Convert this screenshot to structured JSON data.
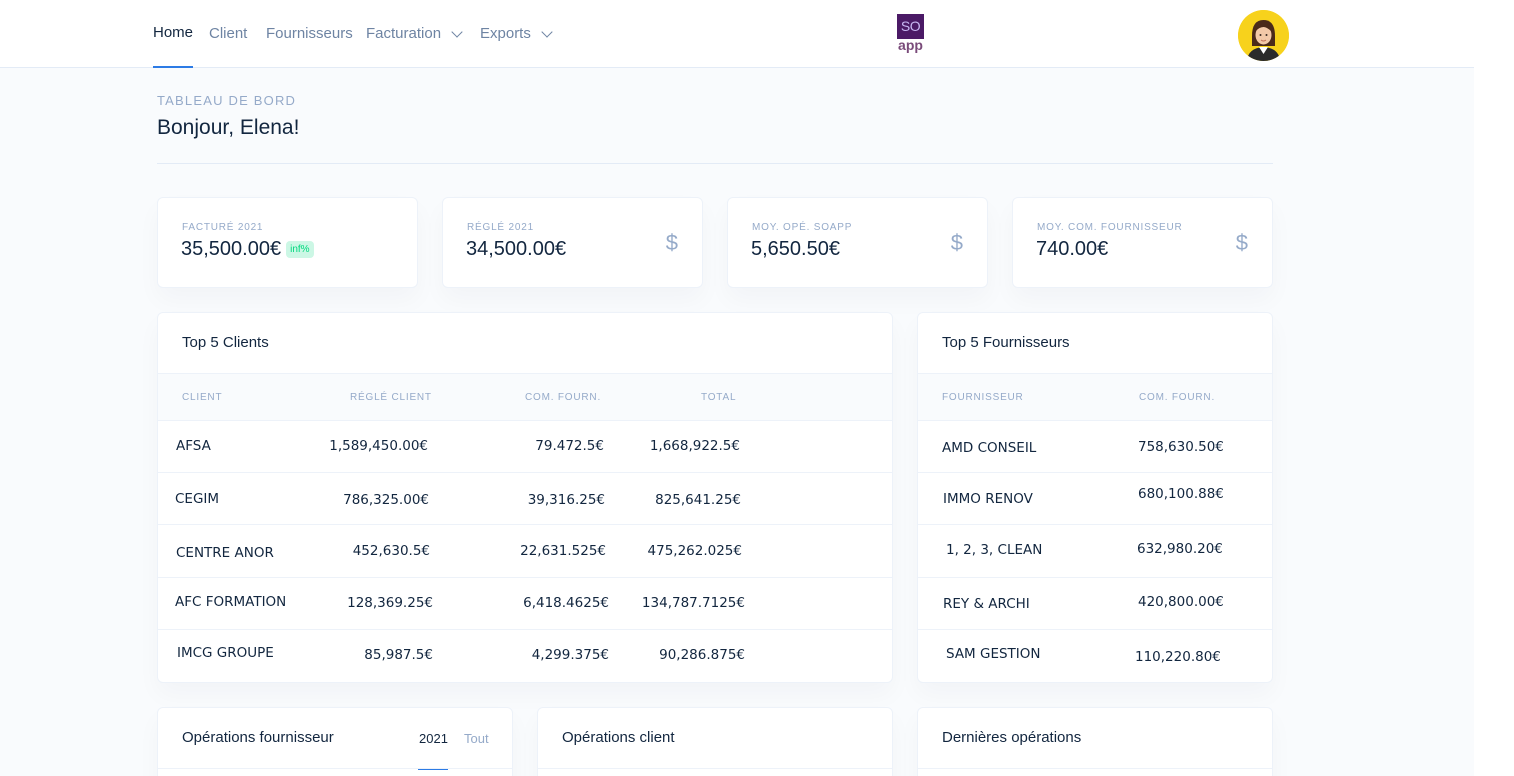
{
  "nav": {
    "items": [
      {
        "label": "Home"
      },
      {
        "label": "Client"
      },
      {
        "label": "Fournisseurs"
      },
      {
        "label": "Facturation"
      },
      {
        "label": "Exports"
      }
    ],
    "logo_top": "SO",
    "logo_bottom": "app"
  },
  "header": {
    "pretitle": "TABLEAU DE BORD",
    "title": "Bonjour, Elena!"
  },
  "kpis": [
    {
      "label": "FACTURÉ 2021",
      "value": "35,500.00€",
      "badge": "inf%"
    },
    {
      "label": "RÉGLÉ 2021",
      "value": "34,500.00€",
      "icon": "$"
    },
    {
      "label": "MOY. OPÉ. SOAPP",
      "value": "5,650.50€",
      "icon": "$"
    },
    {
      "label": "MOY. COM. FOURNISSEUR",
      "value": "740.00€",
      "icon": "$"
    }
  ],
  "clients": {
    "title": "Top 5 Clients",
    "headers": [
      "CLIENT",
      "RÉGLÉ CLIENT",
      "COM. FOURN.",
      "TOTAL"
    ],
    "rows": [
      [
        "AFSA",
        "1,589,450.00€",
        "79.472.5€",
        "1,668,922.5€"
      ],
      [
        "CEGIM",
        "786,325.00€",
        "39,316.25€",
        "825,641.25€"
      ],
      [
        "CENTRE ANOR",
        "452,630.5€",
        "22,631.525€",
        "475,262.025€"
      ],
      [
        "AFC FORMATION",
        "128,369.25€",
        "6,418.4625€",
        "134,787.7125€"
      ],
      [
        "IMCG GROUPE",
        "85,987.5€",
        "4,299.375€",
        "90,286.875€"
      ]
    ]
  },
  "fournisseurs": {
    "title": "Top 5 Fournisseurs",
    "headers": [
      "FOURNISSEUR",
      "COM. FOURN."
    ],
    "rows": [
      [
        "AMD CONSEIL",
        "758,630.50€"
      ],
      [
        "IMMO RENOV",
        "680,100.88€"
      ],
      [
        "1, 2, 3, CLEAN",
        "632,980.20€"
      ],
      [
        "REY & ARCHI",
        "420,800.00€"
      ],
      [
        "SAM GESTION",
        "110,220.80€"
      ]
    ]
  },
  "bottom": {
    "ops_fournisseur": {
      "title": "Opérations fournisseur",
      "tabs": [
        "2021",
        "Tout"
      ]
    },
    "ops_client": {
      "title": "Opérations client"
    },
    "last_ops": {
      "title": "Dernières opérations"
    }
  }
}
